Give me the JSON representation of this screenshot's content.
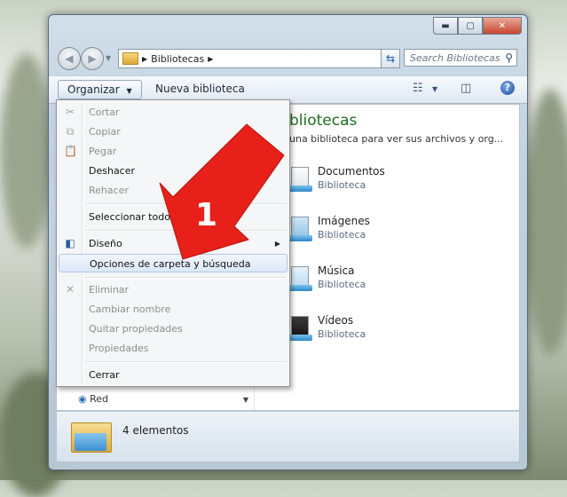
{
  "window": {
    "caption_min": "▬",
    "caption_max": "▢",
    "caption_close": "✕"
  },
  "navbar": {
    "back_glyph": "◀",
    "forward_glyph": "▶",
    "address_crumb": "Bibliotecas",
    "search_placeholder": "Search Bibliotecas"
  },
  "toolbar": {
    "organize_label": "Organizar",
    "new_library_label": "Nueva biblioteca"
  },
  "content": {
    "title": "bliotecas",
    "subtitle": "una biblioteca para ver sus archivos y org...",
    "libraries": [
      {
        "name": "Documentos",
        "type": "Biblioteca"
      },
      {
        "name": "Imágenes",
        "type": "Biblioteca"
      },
      {
        "name": "Música",
        "type": "Biblioteca"
      },
      {
        "name": "Vídeos",
        "type": "Biblioteca"
      }
    ],
    "nav_partial_label": "Red"
  },
  "status": {
    "count_text": "4 elementos"
  },
  "menu": {
    "items": [
      {
        "label": "Cortar",
        "disabled": true
      },
      {
        "label": "Copiar",
        "disabled": true
      },
      {
        "label": "Pegar",
        "disabled": true
      },
      {
        "label": "Deshacer",
        "disabled": false
      },
      {
        "label": "Rehacer",
        "disabled": true
      },
      {
        "label": "Seleccionar todo",
        "disabled": false
      },
      {
        "label": "Diseño",
        "disabled": false
      },
      {
        "label": "Opciones de carpeta y búsqueda",
        "disabled": false
      },
      {
        "label": "Eliminar",
        "disabled": true
      },
      {
        "label": "Cambiar nombre",
        "disabled": true
      },
      {
        "label": "Quitar propiedades",
        "disabled": true
      },
      {
        "label": "Propiedades",
        "disabled": true
      },
      {
        "label": "Cerrar",
        "disabled": false
      }
    ]
  },
  "annotation": {
    "step_number": "1",
    "arrow_color": "#e8201a"
  }
}
